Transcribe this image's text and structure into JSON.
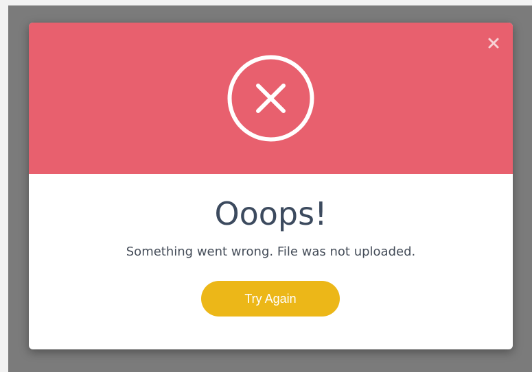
{
  "dialog": {
    "title": "Ooops!",
    "message": "Something went wrong. File was not uploaded.",
    "button_label": "Try Again",
    "close_icon": "close-icon",
    "status_icon": "error-x-circle-icon"
  },
  "colors": {
    "header": "#e8606e",
    "button": "#ecb718",
    "title_text": "#3c4a5e",
    "overlay": "#7b7b7b"
  }
}
